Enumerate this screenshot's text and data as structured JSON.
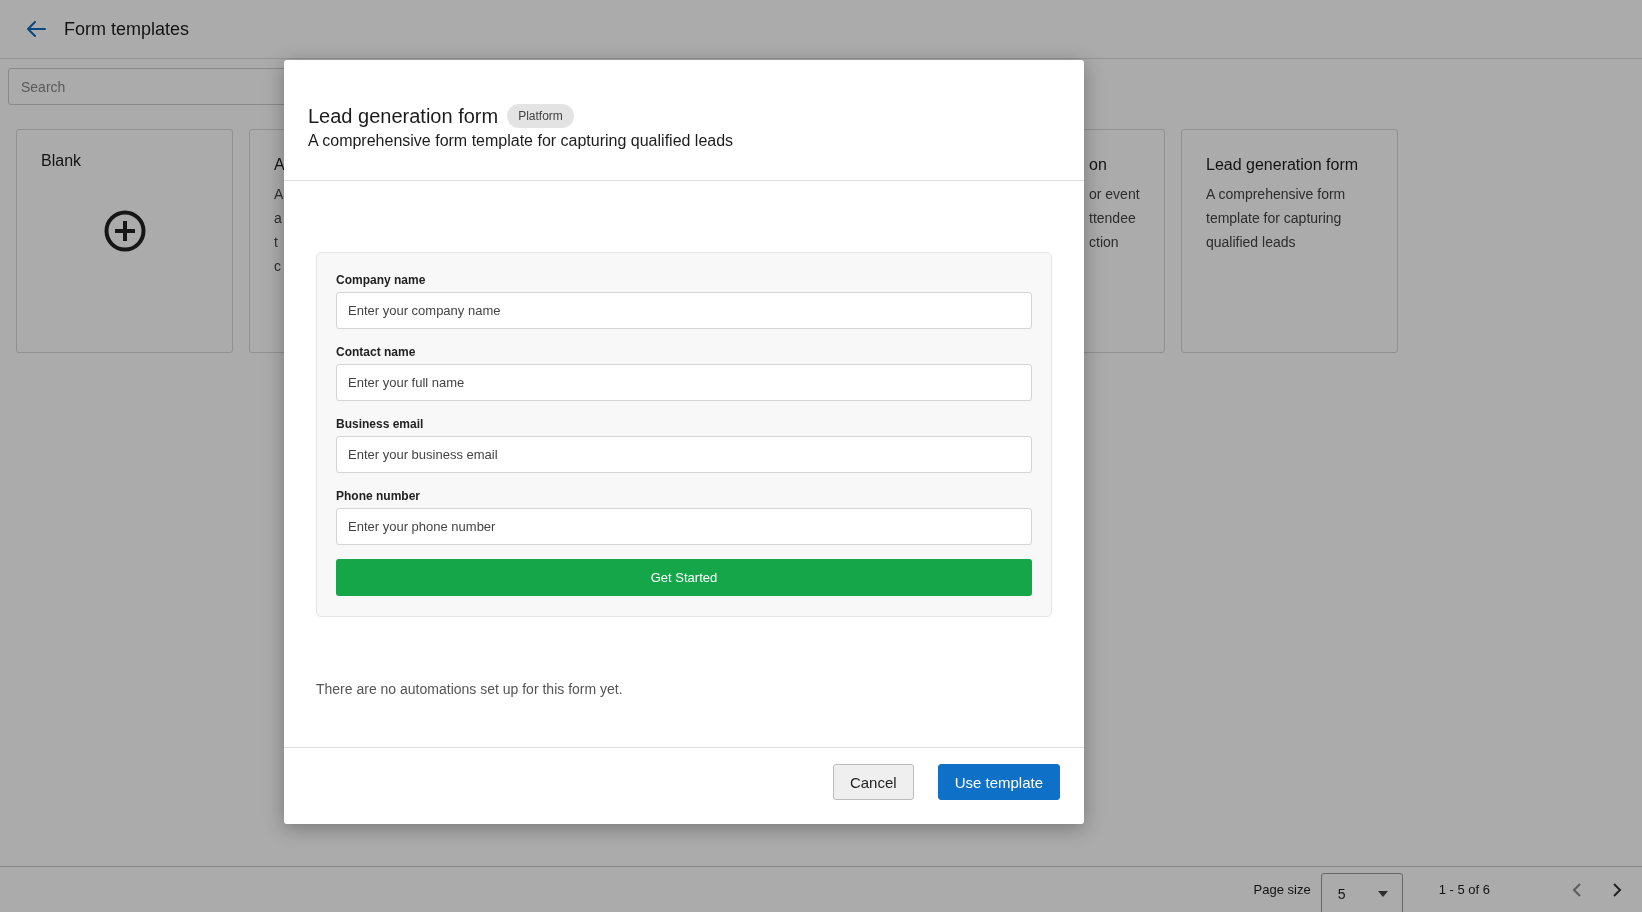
{
  "header": {
    "title": "Form templates"
  },
  "search": {
    "placeholder": "Search"
  },
  "cards": [
    {
      "kind": "blank",
      "title": "Blank"
    },
    {
      "kind": "template",
      "title": "A",
      "description_lines": [
        "A",
        "a",
        "t",
        "c"
      ]
    },
    {
      "kind": "covered"
    },
    {
      "kind": "covered"
    },
    {
      "kind": "clipped",
      "title": "on",
      "description_lines": [
        "or event",
        "ttendee",
        "ction"
      ]
    },
    {
      "kind": "template",
      "title": "Lead generation form",
      "description": "A comprehensive form template for capturing qualified leads"
    }
  ],
  "pagination": {
    "page_size_label": "Page size",
    "page_size": "5",
    "range": "1 - 5 of 6",
    "previous_disabled": true,
    "next_disabled": false
  },
  "modal": {
    "title": "Lead generation form",
    "badge": "Platform",
    "description": "A comprehensive form template for capturing qualified leads",
    "preview": {
      "fields": [
        {
          "label": "Company name",
          "placeholder": "Enter your company name"
        },
        {
          "label": "Contact name",
          "placeholder": "Enter your full name"
        },
        {
          "label": "Business email",
          "placeholder": "Enter your business email"
        },
        {
          "label": "Phone number",
          "placeholder": "Enter your phone number"
        }
      ],
      "button": "Get Started"
    },
    "automations_note": "There are no automations set up for this form yet.",
    "buttons": [
      {
        "kind": "secondary",
        "label": "Cancel"
      },
      {
        "kind": "primary",
        "label": "Use template"
      }
    ]
  }
}
